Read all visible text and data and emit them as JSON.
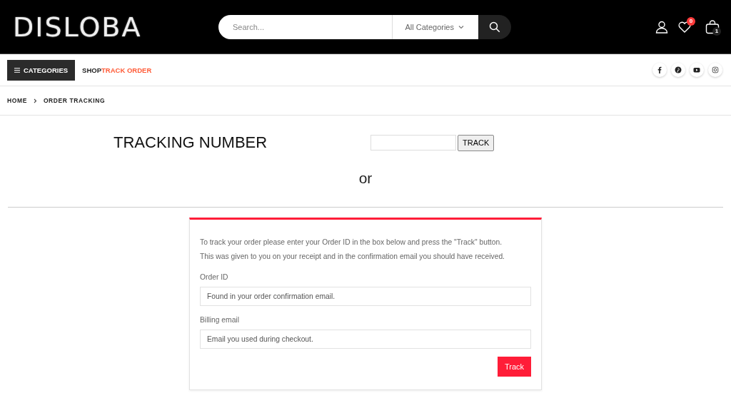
{
  "header": {
    "logo": "DISLOBA",
    "search": {
      "placeholder": "Search...",
      "category": "All Categories"
    },
    "wishlist_count": "0",
    "cart_count": "1"
  },
  "nav": {
    "categories_button": "CATEGORIES",
    "links": [
      {
        "label": "SHOP",
        "selected": false
      },
      {
        "label": "TRACK ORDER",
        "selected": true
      }
    ]
  },
  "breadcrumb": [
    "HOME",
    "ORDER TRACKING"
  ],
  "tracking": {
    "label": "TRACKING NUMBER",
    "button": "TRACK",
    "separator": "or"
  },
  "order_form": {
    "intro": [
      "To track your order please enter your Order ID in the box below and press the \"Track\" button.",
      "This was given to you on your receipt and in the confirmation email you should have received."
    ],
    "fields": [
      {
        "label": "Order ID",
        "placeholder": "Found in your order confirmation email."
      },
      {
        "label": "Billing email",
        "placeholder": "Email you used during checkout."
      }
    ],
    "submit": "Track"
  }
}
